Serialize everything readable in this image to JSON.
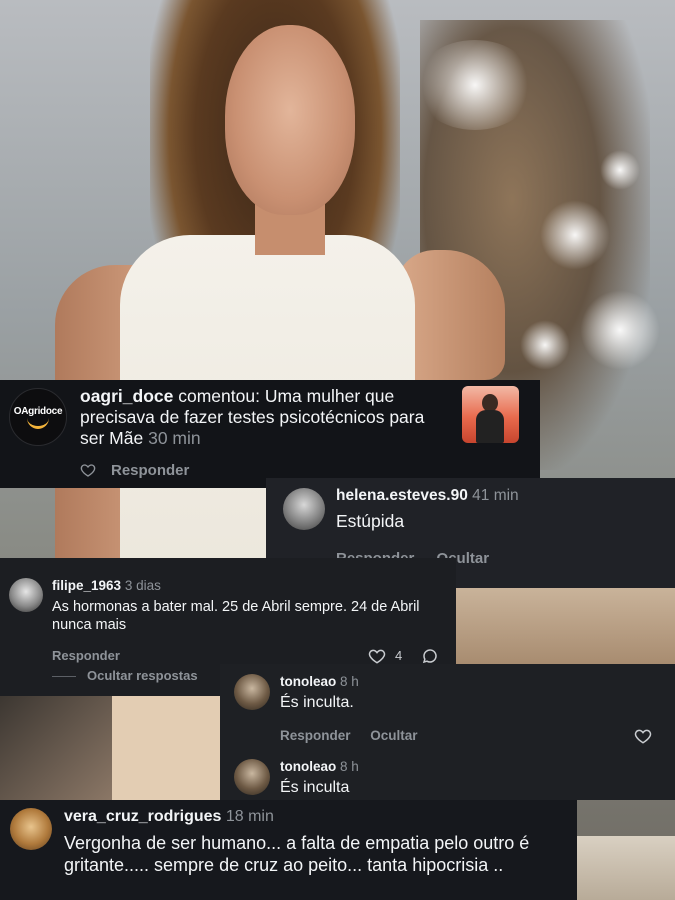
{
  "comments": [
    {
      "avatar_text": "OAgridoce",
      "username": "oagri_doce",
      "verb": "comentou:",
      "text": "Uma mulher que precisava de fazer testes psicotécnicos para ser Mãe",
      "time": "30 min",
      "reply_label": "Responder"
    },
    {
      "username": "helena.esteves.90",
      "time": "41 min",
      "text": "Estúpida",
      "reply_label": "Responder",
      "hide_label": "Ocultar"
    },
    {
      "username": "filipe_1963",
      "time": "3 dias",
      "text": "As hormonas a bater mal. 25 de Abril sempre. 24 de Abril nunca mais",
      "reply_label": "Responder",
      "likes": "4",
      "hide_replies_label": "Ocultar respostas"
    },
    {
      "username": "tonoleao",
      "time": "8 h",
      "text": "És inculta.",
      "reply_label": "Responder",
      "hide_label": "Ocultar"
    },
    {
      "username": "tonoleao",
      "time": "8 h",
      "text": "És inculta"
    },
    {
      "username": "vera_cruz_rodrigues",
      "time": "18 min",
      "text": "Vergonha de ser humano... a falta de empatia pelo outro é gritante..... sempre de cruz ao peito... tanta hipocrisia .."
    }
  ],
  "colors": {
    "card_bg": "#16181d",
    "muted": "#8e9399",
    "accent": "#f2b33b"
  }
}
